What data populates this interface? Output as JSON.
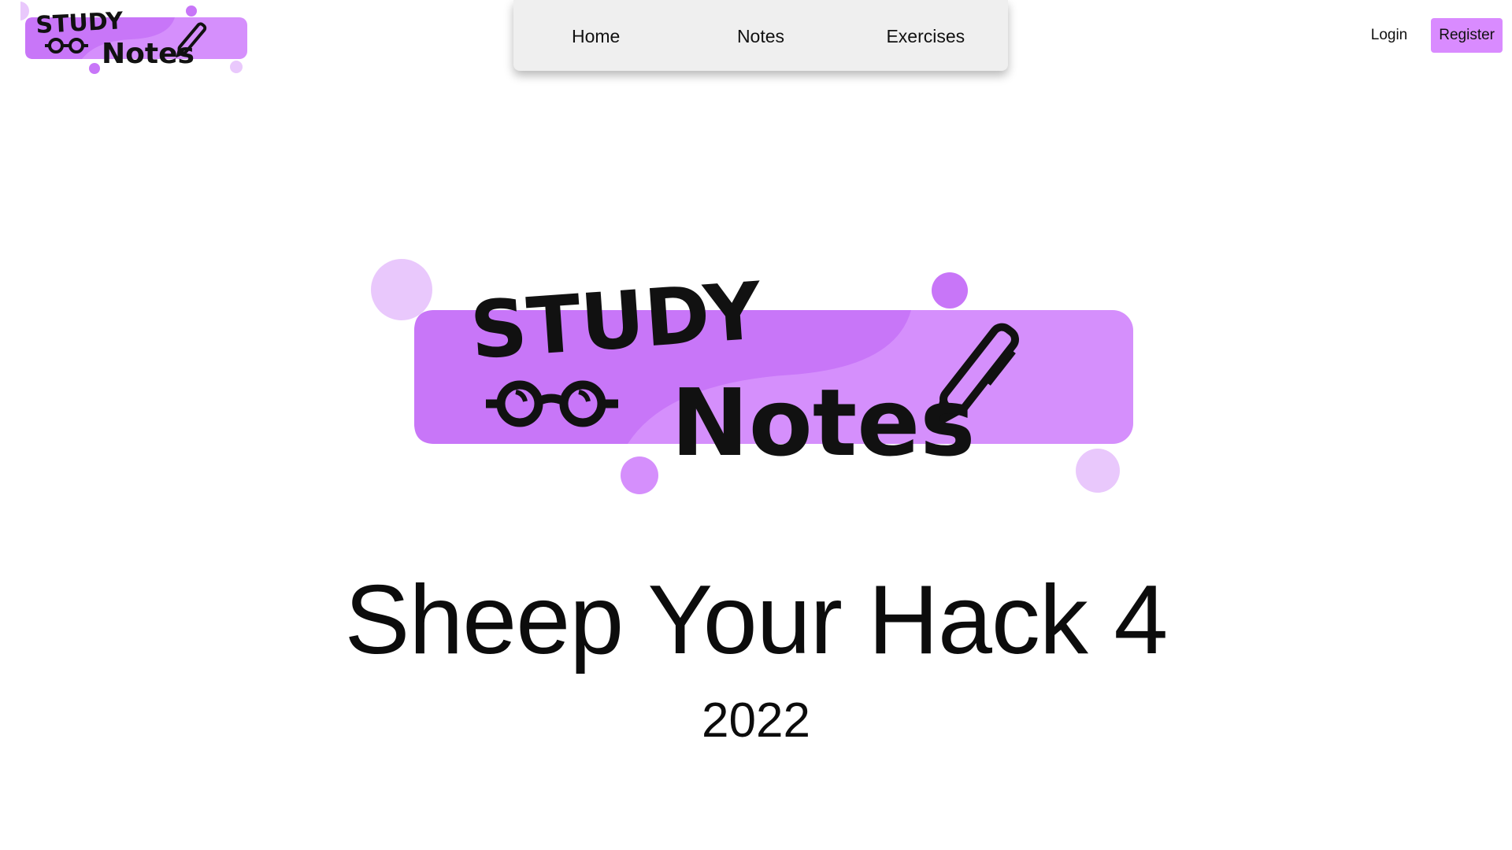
{
  "header": {
    "logo": {
      "line1": "STUDY",
      "line2": "Notes"
    },
    "nav": [
      {
        "label": "Home"
      },
      {
        "label": "Notes"
      },
      {
        "label": "Exercises"
      }
    ],
    "auth": {
      "login_label": "Login",
      "register_label": "Register"
    }
  },
  "hero": {
    "logo": {
      "line1": "STUDY",
      "line2": "Notes"
    },
    "title": "Sheep Your Hack 4",
    "year": "2022"
  },
  "colors": {
    "brand_purple": "#c876f8",
    "brand_purple_light": "#d58ffc",
    "bubble_light": "#e9c8fc",
    "register_bg": "#d98bff",
    "nav_bg": "#efefef"
  },
  "icons": {
    "pen": "pen-icon",
    "glasses": "glasses-icon"
  }
}
